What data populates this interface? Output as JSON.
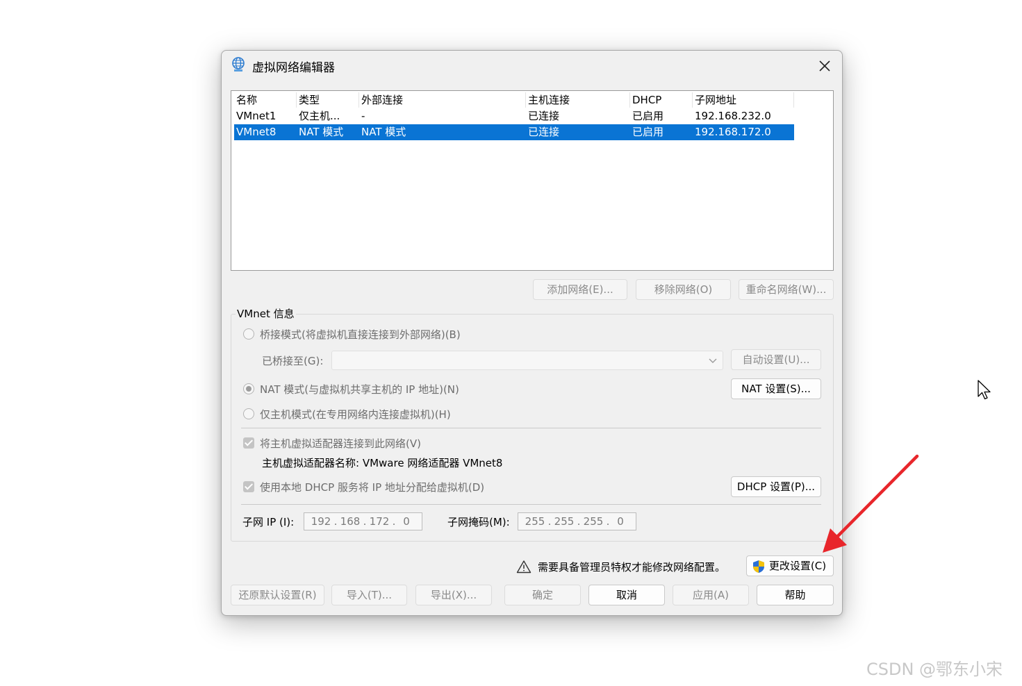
{
  "window": {
    "title": "虚拟网络编辑器"
  },
  "table": {
    "headers": [
      "名称",
      "类型",
      "外部连接",
      "主机连接",
      "DHCP",
      "子网地址"
    ],
    "rows": [
      [
        "VMnet1",
        "仅主机...",
        "-",
        "已连接",
        "已启用",
        "192.168.232.0"
      ],
      [
        "VMnet8",
        "NAT 模式",
        "NAT 模式",
        "已连接",
        "已启用",
        "192.168.172.0"
      ]
    ],
    "selected_row": 1
  },
  "list_buttons": {
    "add": "添加网络(E)...",
    "remove": "移除网络(O)",
    "rename": "重命名网络(W)..."
  },
  "vmnet_info": {
    "title": "VMnet 信息",
    "bridged_label": "桥接模式(将虚拟机直接连接到外部网络)(B)",
    "bridged_to_label": "已桥接至(G):",
    "auto_settings": "自动设置(U)...",
    "nat_label": "NAT 模式(与虚拟机共享主机的 IP 地址)(N)",
    "nat_settings": "NAT 设置(S)...",
    "hostonly_label": "仅主机模式(在专用网络内连接虚拟机)(H)",
    "connect_adapter_label": "将主机虚拟适配器连接到此网络(V)",
    "adapter_name_label": "主机虚拟适配器名称: VMware 网络适配器 VMnet8",
    "dhcp_label": "使用本地 DHCP 服务将 IP 地址分配给虚拟机(D)",
    "dhcp_settings": "DHCP 设置(P)...",
    "subnet_ip_label": "子网 IP (I):",
    "subnet_ip": [
      "192",
      "168",
      "172",
      "0"
    ],
    "subnet_mask_label": "子网掩码(M):",
    "subnet_mask": [
      "255",
      "255",
      "255",
      "0"
    ],
    "selected_mode": "nat"
  },
  "admin": {
    "message": "需要具备管理员特权才能修改网络配置。",
    "change_settings": "更改设置(C)"
  },
  "footer": {
    "restore": "还原默认设置(R)",
    "import": "导入(T)...",
    "export": "导出(X)...",
    "ok": "确定",
    "cancel": "取消",
    "apply": "应用(A)",
    "help": "帮助"
  },
  "watermark": "CSDN @鄂东小宋",
  "colors": {
    "selection": "#0a74d4",
    "dialog_bg": "#f0f0f0",
    "arrow": "#e8262b"
  }
}
